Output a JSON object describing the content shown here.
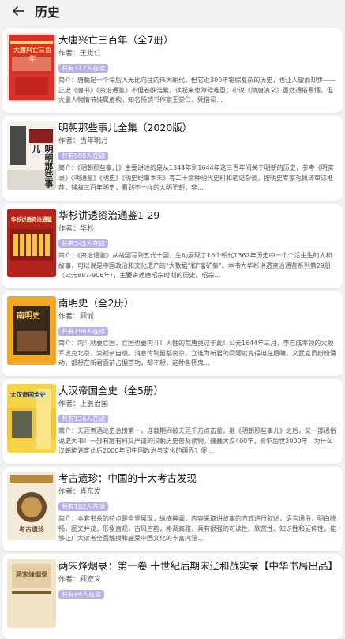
{
  "header": {
    "title": "历史"
  },
  "books": [
    {
      "title": "大唐兴亡三百年（全7册）",
      "author": "作者：王觉仁",
      "badge": "共有317人在读",
      "desc": "简介：唐朝是一个令后人无比向往的伟大朝代，但它近300年错综复杂的历史，也让人望而却步——正史《唐书》《资治通鉴》不但卷帙浩繁，读起来也障碍难重；小说《隋唐演义》虽然通俗易懂，但大量人物情节纯属虚构。知名畅销书作家王觉仁，凭借深...",
      "cover_text": "大唐兴亡三百年",
      "cover_colors": [
        "#d9302a",
        "#f3d36a"
      ]
    },
    {
      "title": "明朝那些事儿全集（2020版）",
      "author": "作者：当年明月",
      "badge": "共有989人在读",
      "desc": "简介：《明朝那些事儿》主要讲述的是从1344年到1644年这三百年间关于明朝的历史，参考《明实录》《明通鉴》《明史》《明史纪事本末》等二十余种明代史料和笔记杂谈，按明史专家毛佩琦审订推荐，铺叙三百年明史，看到不一样的大明王朝；非...",
      "cover_text": "明朝那些事儿",
      "cover_colors": [
        "#f4f1ea",
        "#8a1f1f"
      ]
    },
    {
      "title": "华杉讲透资治通鉴1-29",
      "author": "作者：华杉",
      "badge": "共有345人在读",
      "desc": "简介：《资治通鉴》从战国写到五代十国，生动展现了16个朝代1362年历史中一个个活生生的人和故事，可以说是中国政治和文化遗产的\"大数据\"和\"富矿集\"。本书为华杉讲透资治通鉴系列第29册（公元887-906年），主要讲述唐昭宗时期的历史。昭宗...",
      "cover_text": "华杉讲透资治通鉴",
      "cover_colors": [
        "#b3241c",
        "#f0c93a"
      ]
    },
    {
      "title": "南明史（全2册）",
      "author": "作者：顾诚",
      "badge": "共有198人在读",
      "desc": "简介：内斗就要亡国，亡国也要内斗！人性的荒唐莫过于此！公元1644年三月，李自成率领的大顺军攻克北京，崇祯帝自缢。消息传到留都南京，立谁为新君的问题就变得迫在眉睫，文武官员纷纷涌动，都想在新君面前占据首功，却不想，这种各怀鬼...",
      "cover_text": "南明史",
      "cover_colors": [
        "#f5a623",
        "#3a2a1a"
      ]
    },
    {
      "title": "大汉帝国全史（全5册）",
      "author": "作者：上医治国",
      "badge": "共有126人在读",
      "desc": "简介：天涯煮酒论史总榜第一，连载期间破天涯千万点击量，继《明朝那些事儿》之后，又一部通俗说史大书！一部有趣有料又严谨的汉朝历史普及读物。巍巍大汉400年，影响后世2000年！为什么汉朝能划定此后2000年间中国政治与文化的疆界？促...",
      "cover_text": "大汉帝国全史",
      "cover_colors": [
        "#f7d34a",
        "#1d3b5e"
      ]
    },
    {
      "title": "考古遗珍：中国的十大考古发现",
      "author": "作者：肖东发",
      "badge": "共有102人在读",
      "desc": "简介：本套书系的特点是全景展现，纵横捭阖，内容采取讲故事的方式进行叙述，语言通俗，明白晓畅，图文并茂，形象直观，古风古韵，格调高雅，具有很强的可读性、欣赏性、知识性和延伸性，能够让广大读者全面触摸和感受中国文化的丰富内涵...",
      "cover_text": "考古遗珍",
      "cover_colors": [
        "#f2ead8",
        "#b88a3c"
      ]
    },
    {
      "title": "两宋烽烟录：第一卷 十世纪后期宋辽和战实录【中华书局出品】",
      "author": "作者：顾宏义",
      "badge": "共有98人在读",
      "desc": "",
      "cover_text": "两宋烽烟录",
      "cover_colors": [
        "#f1e4c6",
        "#7a5a2e"
      ]
    }
  ]
}
